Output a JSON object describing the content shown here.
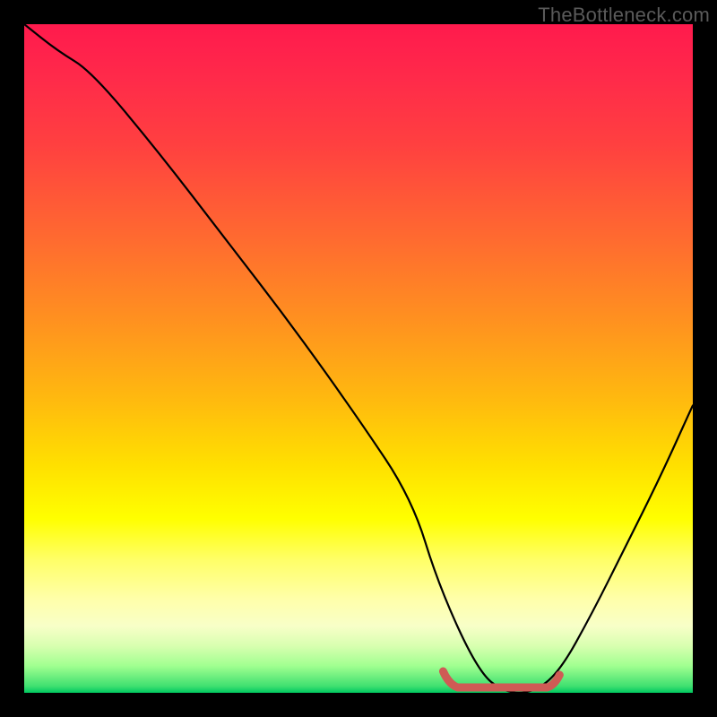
{
  "watermark": "TheBottleneck.com",
  "chart_data": {
    "type": "line",
    "title": "",
    "xlabel": "",
    "ylabel": "",
    "xlim": [
      0,
      100
    ],
    "ylim": [
      0,
      100
    ],
    "x": [
      0,
      5,
      10,
      20,
      30,
      40,
      50,
      58,
      62,
      68,
      72,
      76,
      80,
      85,
      90,
      95,
      100
    ],
    "values": [
      100,
      96,
      93,
      81,
      68,
      55,
      41,
      29,
      16,
      3,
      0,
      0,
      3,
      12,
      22,
      32,
      43
    ],
    "colors": {
      "top": "#ff1a4d",
      "bottom": "#00c860",
      "curve": "#000000",
      "marker": "#d9534f"
    },
    "marker_region": {
      "x_start": 64,
      "x_end": 79,
      "y": 0
    }
  }
}
